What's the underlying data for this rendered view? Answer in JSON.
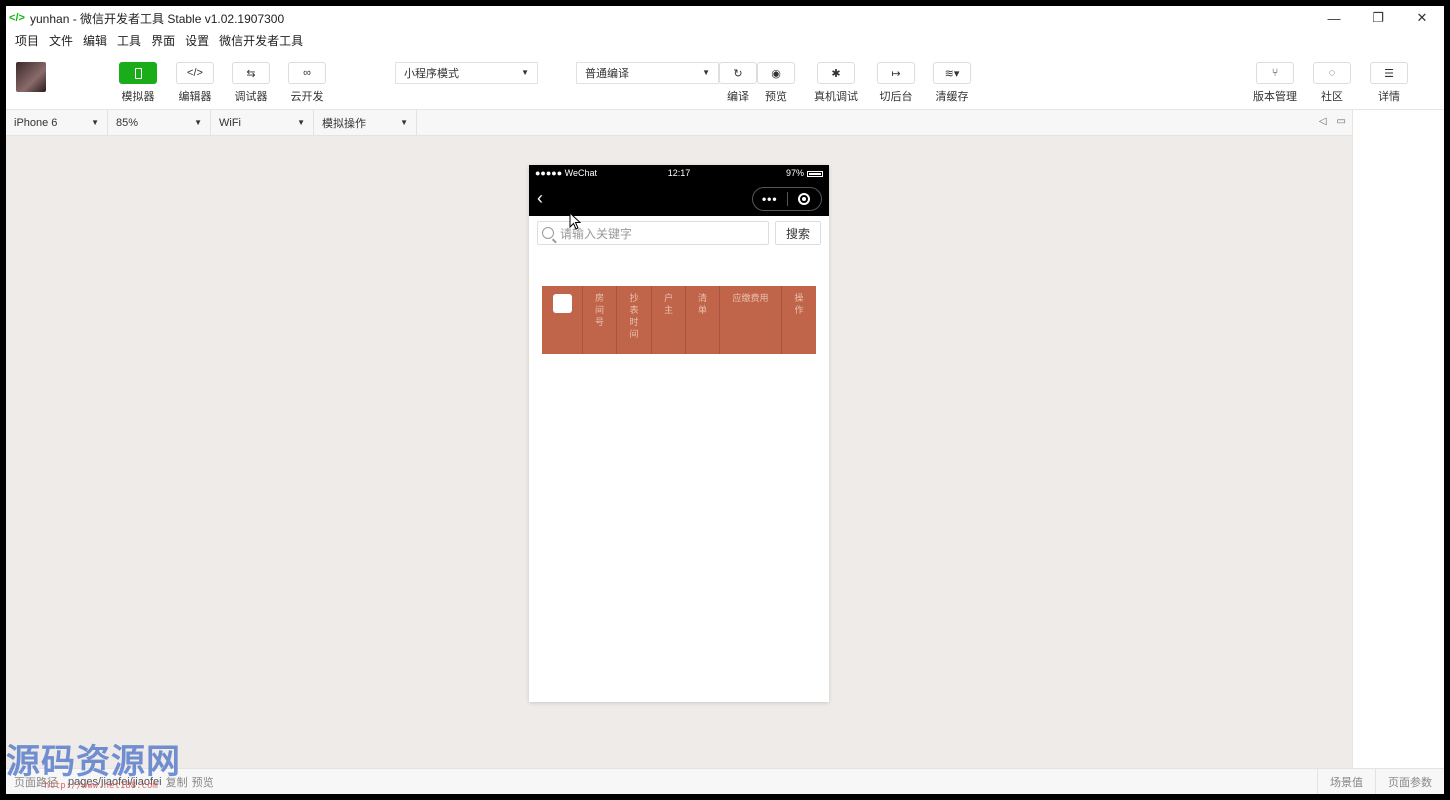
{
  "window": {
    "title": "yunhan - 微信开发者工具 Stable v1.02.1907300",
    "controls": [
      "—",
      "❐",
      "✕"
    ]
  },
  "menu": [
    "项目",
    "文件",
    "编辑",
    "工具",
    "界面",
    "设置",
    "微信开发者工具"
  ],
  "toolbar": {
    "simulator": "模拟器",
    "editor": "编辑器",
    "debugger": "调试器",
    "cloud": "云开发",
    "mode_select": "小程序模式",
    "compile_select": "普通编译",
    "compile": "编译",
    "preview": "预览",
    "remote_debug": "真机调试",
    "background": "切后台",
    "clear_cache": "清缓存",
    "version": "版本管理",
    "community": "社区",
    "details": "详情"
  },
  "device_bar": {
    "device": "iPhone 6",
    "zoom": "85%",
    "network": "WiFi",
    "operation": "模拟操作"
  },
  "phone": {
    "carrier": "●●●●● WeChat",
    "time": "12:17",
    "battery": "97%",
    "search_placeholder": "请输入关键字",
    "search_button": "搜索",
    "table_headers": [
      "房间号",
      "抄表时间",
      "户主",
      "清单",
      "应缴费用",
      "操作"
    ]
  },
  "bottom": {
    "path_label": "页面路径",
    "path": "pages/jiaofei/jiaofei",
    "copy": "复制",
    "preview": "预览",
    "scene": "场景值",
    "page_params": "页面参数"
  },
  "watermark": {
    "text": "源码资源网",
    "url": "http://www.net188.com"
  },
  "colors": {
    "accent_green": "#1aad19",
    "table_header": "#c0654a",
    "sim_bg": "#efebe8"
  }
}
